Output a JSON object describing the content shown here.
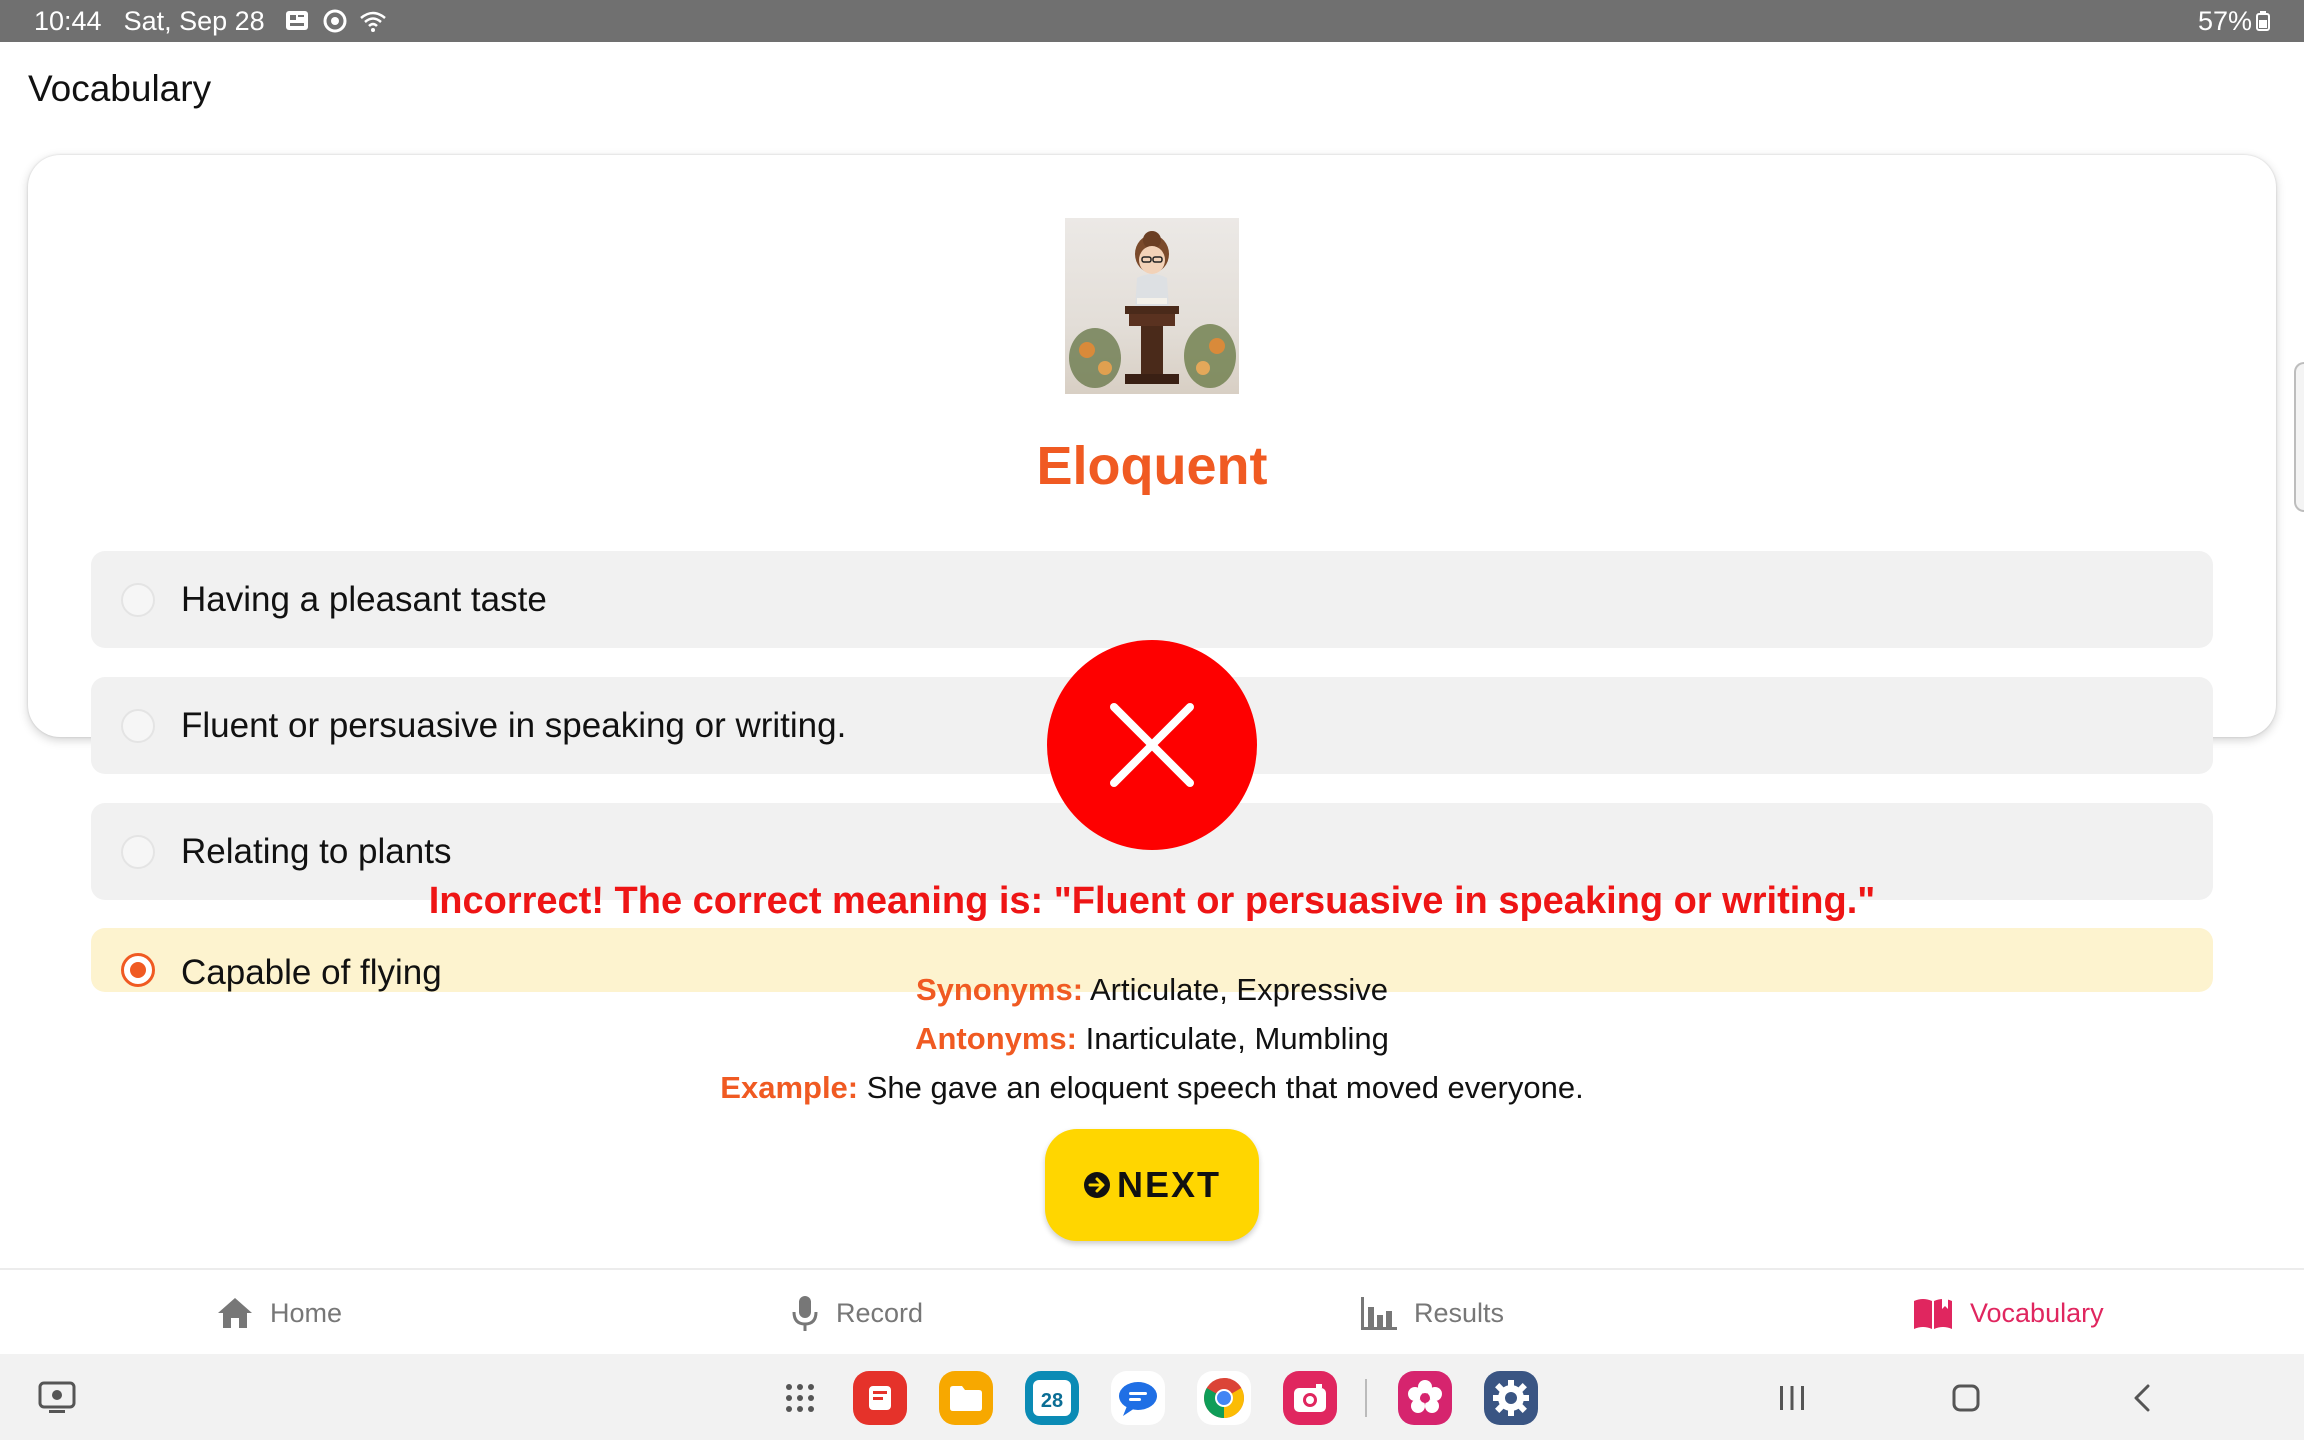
{
  "status_bar": {
    "time": "10:44",
    "date": "Sat, Sep 28",
    "battery": "57%"
  },
  "app": {
    "title": "Vocabulary"
  },
  "word": {
    "title": "Eloquent",
    "image_icon": "speaker-at-podium-illustration"
  },
  "options": [
    {
      "label": "Having a pleasant taste",
      "selected": false
    },
    {
      "label": "Fluent or persuasive in speaking or writing.",
      "selected": false
    },
    {
      "label": "Relating to plants",
      "selected": false
    },
    {
      "label": "Capable of flying",
      "selected": true
    }
  ],
  "result": {
    "icon": "close-icon",
    "feedback": "Incorrect! The correct meaning is: \"Fluent or persuasive in speaking or writing.\"",
    "synonyms_label": "Synonyms:",
    "synonyms": "Articulate, Expressive",
    "antonyms_label": "Antonyms:",
    "antonyms": "Inarticulate, Mumbling",
    "example_label": "Example:",
    "example": "She gave an eloquent speech that moved everyone."
  },
  "next_button": {
    "label": "NEXT"
  },
  "bottom_nav": [
    {
      "label": "Home",
      "icon": "home-icon",
      "active": false
    },
    {
      "label": "Record",
      "icon": "microphone-icon",
      "active": false
    },
    {
      "label": "Results",
      "icon": "bar-chart-icon",
      "active": false
    },
    {
      "label": "Vocabulary",
      "icon": "book-icon",
      "active": true
    }
  ],
  "dock": {
    "calendar_day": "28"
  },
  "colors": {
    "accent": "#f05a22",
    "error": "#fe0000",
    "next_button": "#ffd600",
    "nav_active": "#e0265f",
    "selected_option_bg": "#fdf3cf"
  }
}
